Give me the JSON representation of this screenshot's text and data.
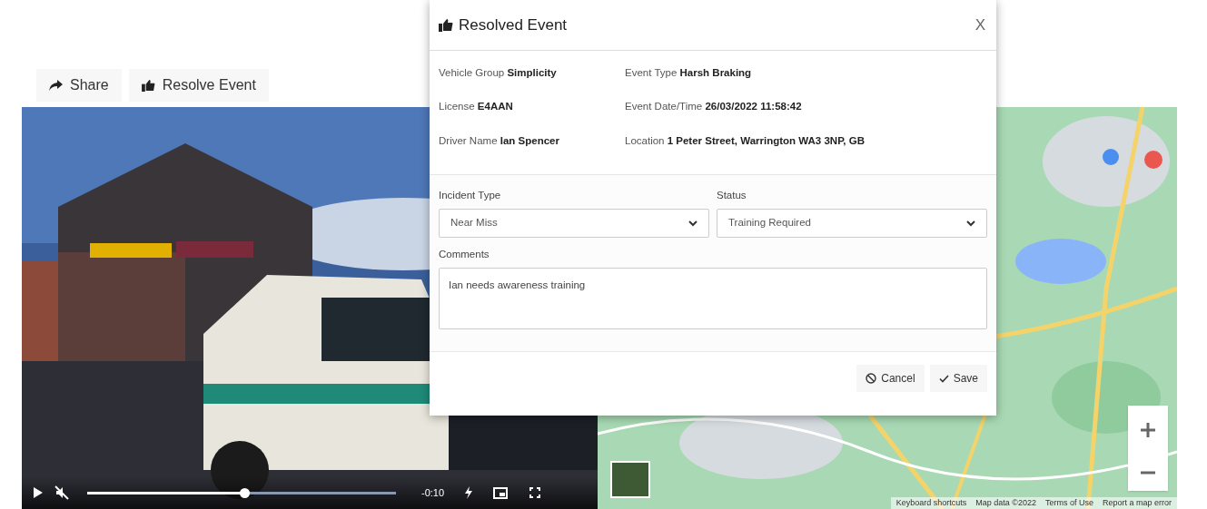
{
  "toolbar": {
    "buttons": [
      {
        "label": "Share",
        "kind": "share"
      },
      {
        "label": "Resolve Event",
        "kind": "resolve"
      }
    ]
  },
  "video": {
    "time": "-0:10",
    "level": 0.51
  },
  "map": {
    "footer_links": [
      "Keyboard shortcuts",
      "Map data ©2022",
      "Terms of Use",
      "Report a map error"
    ]
  },
  "dialog": {
    "title": "Resolved Event",
    "close": "X",
    "details": [
      {
        "label": "Vehicle Group",
        "value": "Simplicity"
      },
      {
        "label": "Event Type",
        "value": "Harsh Braking"
      },
      {
        "label": "License",
        "value": "E4AAN"
      },
      {
        "label": "Event Date/Time",
        "value": "26/03/2022 11:58:42"
      },
      {
        "label": "Driver Name",
        "value": "Ian Spencer"
      },
      {
        "label": "Location",
        "value": "1 Peter Street, Warrington WA3 3NP, GB"
      }
    ],
    "fields": [
      {
        "label": "Incident Type",
        "value": "Near Miss"
      },
      {
        "label": "Status",
        "value": "Training Required"
      }
    ],
    "comments": {
      "label": "Comments",
      "value": "Ian needs awareness training"
    },
    "buttons": [
      {
        "label": "Cancel",
        "kind": "cancel"
      },
      {
        "label": "Save",
        "kind": "save"
      }
    ]
  }
}
